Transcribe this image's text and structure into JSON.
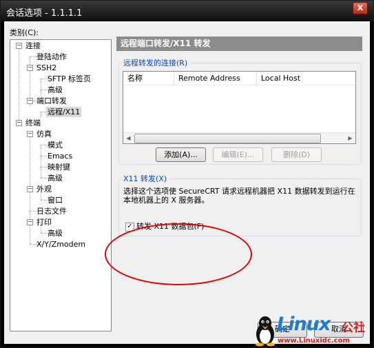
{
  "window": {
    "title": "会话选项 - 1.1.1.1",
    "close_label": "X"
  },
  "category_label": "类别(C):",
  "tree": {
    "items": [
      {
        "label": "连接"
      },
      {
        "label": "登陆动作"
      },
      {
        "label": "SSH2"
      },
      {
        "label": "SFTP 标签页"
      },
      {
        "label": "高级"
      },
      {
        "label": "端口转发"
      },
      {
        "label": "远程/X11"
      },
      {
        "label": "终端"
      },
      {
        "label": "仿真"
      },
      {
        "label": "模式"
      },
      {
        "label": "Emacs"
      },
      {
        "label": "映射键"
      },
      {
        "label": "高级"
      },
      {
        "label": "外观"
      },
      {
        "label": "窗口"
      },
      {
        "label": "日志文件"
      },
      {
        "label": "打印"
      },
      {
        "label": "高级"
      },
      {
        "label": "X/Y/Zmodem"
      }
    ],
    "expander_minus": "−"
  },
  "panel_title": "远程端口转发/X11 转发",
  "remote_group": {
    "title": "远程转发的连接(R)",
    "columns": [
      "名称",
      "Remote Address",
      "Local Host"
    ],
    "scroll_left": "◀",
    "scroll_right": "▶"
  },
  "buttons": {
    "add": "添加(A)...",
    "edit": "编辑(E)...",
    "delete": "删除(D)"
  },
  "x11_group": {
    "title": "X11 转发(X)",
    "description": "选择这个选项使 SecureCRT 请求远程机器把 X11 数据转发到运行在本地机器上的 X 服务器。",
    "checkbox_label": "转发 X11 数据包(F)",
    "checkbox_checked": true,
    "check_mark": "✓"
  },
  "bottom_buttons": {
    "ok": "确定",
    "cancel": "取消"
  },
  "watermark": {
    "text": "Linux",
    "suffix": "公社",
    "url": "www.Linuxidc.com"
  }
}
